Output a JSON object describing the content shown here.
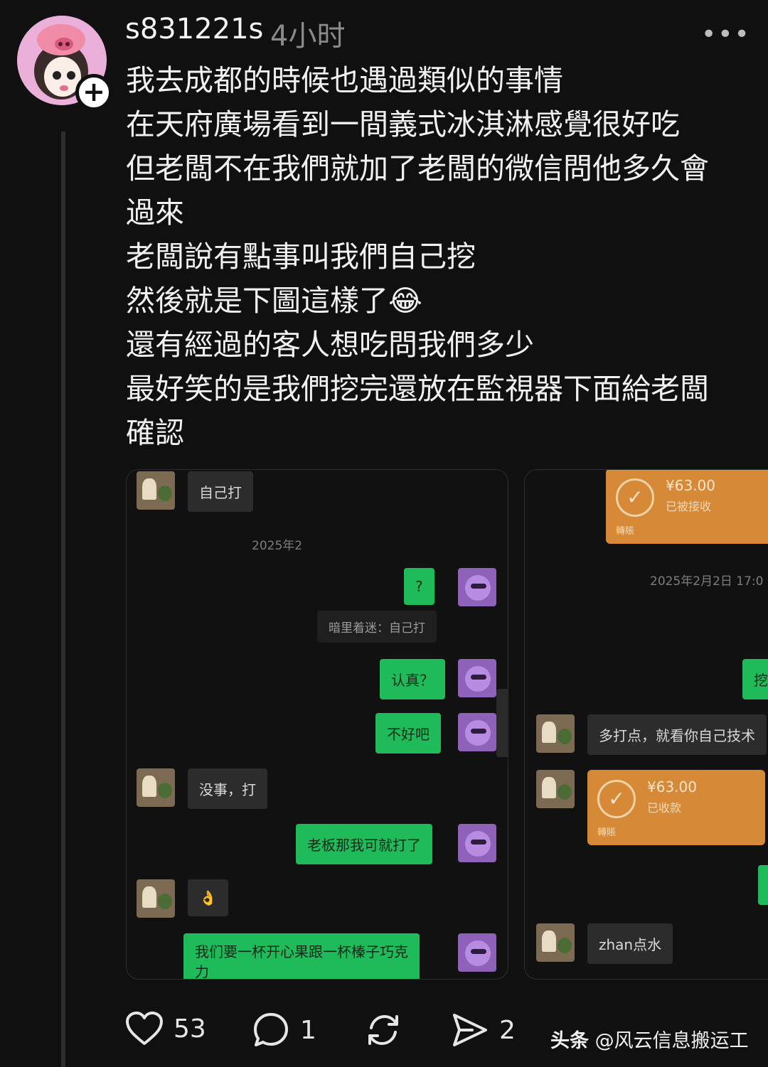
{
  "post": {
    "username": "s831221s",
    "time": "4小时",
    "more": "•••",
    "follow": "+",
    "lines": [
      "我去成都的時候也遇過類似的事情",
      "在天府廣場看到一間義式冰淇淋感覺很好吃",
      "但老闆不在我們就加了老闆的微信問他多久會",
      "過來",
      "老闆說有點事叫我們自己挖",
      "然後就是下圖這樣了😂",
      "還有經過的客人想吃問我們多少",
      "最好笑的是我們挖完還放在監視器下面給老闆",
      "確認"
    ]
  },
  "chat_left": {
    "msg1": "自己打",
    "date": "2025年2",
    "out1": "?",
    "quote": "暗里着迷：自己打",
    "out2": "认真？",
    "out3": "不好吧",
    "in2": "没事，打",
    "out4": "老板那我可就打了",
    "in3": "👌",
    "out5_line1": "我们要一杯开心果跟一杯榛子巧克",
    "out5_line2": "力"
  },
  "chat_right": {
    "transfer1_amount": "¥63.00",
    "transfer1_status": "已被接收",
    "transfer1_label": "轉賬",
    "date": "2025年2月2日 17:0",
    "out_partial": "挖",
    "in1": "多打点，就看你自己技术",
    "transfer2_amount": "¥63.00",
    "transfer2_status": "已收款",
    "transfer2_label": "轉賬",
    "in2": "zhan点水"
  },
  "actions": {
    "likes": "53",
    "comments": "1",
    "shares": "2"
  },
  "watermark": {
    "brand": "头条",
    "handle": "@风云信息搬运工"
  }
}
